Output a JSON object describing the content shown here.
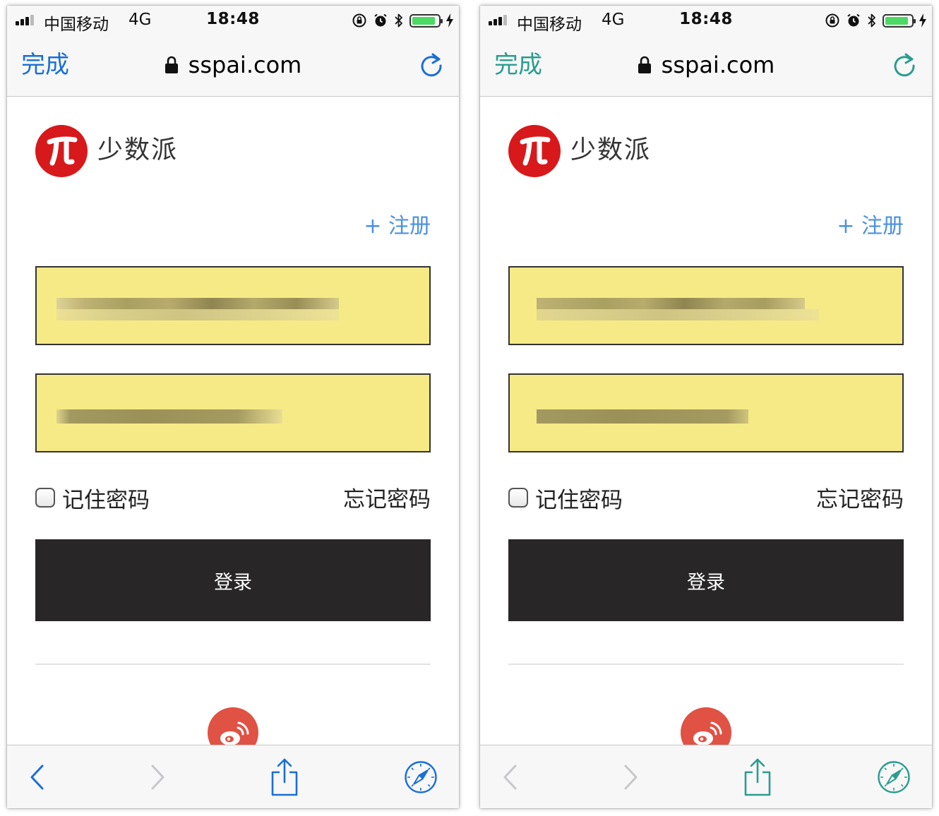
{
  "screens": [
    {
      "accent": "#1a6fd6",
      "status_bar": {
        "carrier": "中国移动",
        "network": "4G",
        "time": "18:48",
        "battery_level": 0.9
      },
      "address_bar": {
        "done_label": "完成",
        "url": "sspai.com",
        "secure": true
      },
      "page": {
        "brand": "少数派",
        "register_label": "+ 注册",
        "remember_label": "记住密码",
        "remember_checked": false,
        "forgot_label": "忘记密码",
        "login_label": "登录",
        "username_value_obscured": true,
        "password_value_obscured": true
      },
      "toolbar": {
        "back_enabled": true,
        "forward_enabled": false,
        "icons": [
          "chevron-left-icon",
          "chevron-right-icon",
          "share-icon",
          "compass-icon"
        ]
      }
    },
    {
      "accent": "#2a9d8f",
      "status_bar": {
        "carrier": "中国移动",
        "network": "4G",
        "time": "18:48",
        "battery_level": 0.9
      },
      "address_bar": {
        "done_label": "完成",
        "url": "sspai.com",
        "secure": true
      },
      "page": {
        "brand": "少数派",
        "register_label": "+ 注册",
        "remember_label": "记住密码",
        "remember_checked": false,
        "forgot_label": "忘记密码",
        "login_label": "登录",
        "username_value_obscured": true,
        "password_value_obscured": true
      },
      "toolbar": {
        "back_enabled": false,
        "forward_enabled": false,
        "icons": [
          "chevron-left-icon",
          "chevron-right-icon",
          "share-icon",
          "compass-icon"
        ]
      }
    }
  ],
  "colors": {
    "chrome_bg": "#f7f7f7",
    "register_link": "#4a90e2",
    "field_bg": "#f6ea86",
    "login_button": "#282627",
    "logo_red": "#d7191c",
    "weibo_red": "#e05244",
    "battery_green": "#4cd964",
    "disabled": "#c7c7cc"
  }
}
